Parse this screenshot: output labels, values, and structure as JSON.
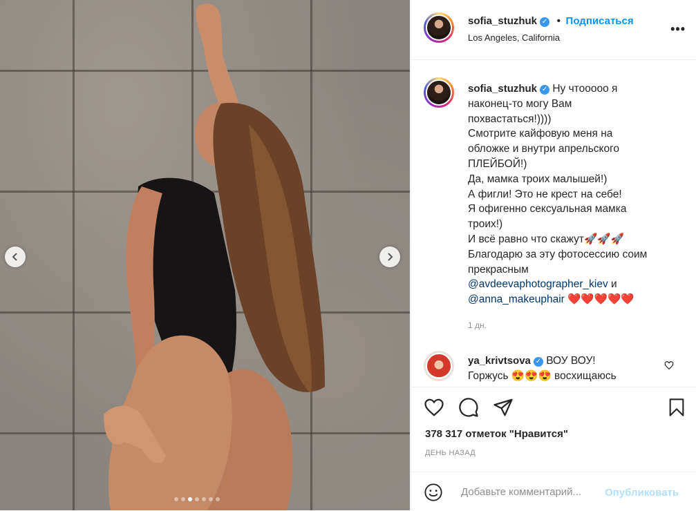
{
  "post": {
    "username": "sofia_stuzhuk",
    "verified_mark": "✓",
    "separator": "•",
    "follow_label": "Подписаться",
    "location": "Los Angeles, California",
    "more_label": "•••"
  },
  "caption": {
    "username": "sofia_stuzhuk",
    "lines": [
      "Ну чтооооо я",
      "наконец-то могу Вам",
      "похвастаться!))))",
      "Смотрите кайфовую меня на",
      "обложке и внутри апрельского",
      "ПЛЕЙБОЙ!)",
      "Да, мамка троих малышей!)",
      "А фигли! Это не крест на себе!",
      "Я офигенно сексуальная мамка",
      "троих!)",
      "И всё равно что скажут🚀🚀🚀",
      "Благодарю за эту фотосессию соим",
      "прекрасным"
    ],
    "mention1": "@avdeevaphotographer_kiev",
    "and_word": " и",
    "mention2": "@anna_makeuphair",
    "hearts": " ❤️❤️❤️❤️❤️",
    "time": "1 дн."
  },
  "comment": {
    "username": "ya_krivtsova",
    "text1": "ВОУ ВОУ!",
    "text2": "Горжусь 😍😍😍 восхищаюсь"
  },
  "likes": "378 317 отметок \"Нравится\"",
  "date": "ДЕНЬ НАЗАД",
  "add_comment": {
    "placeholder": "Добавьте комментарий...",
    "post_label": "Опубликовать"
  },
  "carousel": {
    "dot_count": 7,
    "active_index": 2
  },
  "icons": {
    "like": "heart-icon",
    "comment": "comment-icon",
    "share": "share-icon",
    "save": "bookmark-icon",
    "emoji": "emoji-icon",
    "prev": "chevron-left-icon",
    "next": "chevron-right-icon"
  },
  "colors": {
    "link": "#0095f6",
    "mention": "#00376b",
    "muted": "#8e8e8e"
  }
}
